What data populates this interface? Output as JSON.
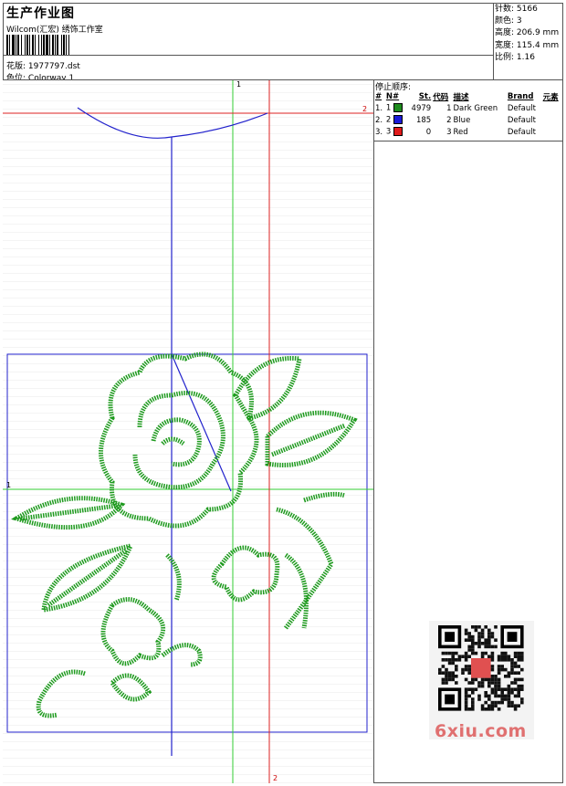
{
  "header": {
    "title": "生产作业图",
    "company": "Wilcom(汇宏) 绣饰工作室",
    "design_label": "花版:",
    "design_value": "1977797.dst",
    "colorway_label": "色位:",
    "colorway_value": "Colorway 1"
  },
  "stats": {
    "stitches_label": "针数:",
    "stitches_value": "5166",
    "colors_label": "颜色:",
    "colors_value": "3",
    "height_label": "高度:",
    "height_value": "206.9 mm",
    "width_label": "宽度:",
    "width_value": "115.4 mm",
    "ratio_label": "比例:",
    "ratio_value": "1.16"
  },
  "stop_sequence": {
    "title": "停止顺序:",
    "columns": [
      "#",
      "N#",
      "St.",
      "代码",
      "描述",
      "Brand",
      "元素"
    ],
    "rows": [
      {
        "index": "1.",
        "n": "1",
        "color": "#1e8c1e",
        "stitches": "4979",
        "code": "1",
        "desc": "Dark Green",
        "brand": "Default"
      },
      {
        "index": "2.",
        "n": "2",
        "color": "#1a1ad8",
        "stitches": "185",
        "code": "2",
        "desc": "Blue",
        "brand": "Default"
      },
      {
        "index": "3.",
        "n": "3",
        "color": "#e01a1a",
        "stitches": "0",
        "code": "3",
        "desc": "Red",
        "brand": "Default"
      }
    ]
  },
  "canvas": {
    "marker_top": "1",
    "marker_right": "2",
    "marker_left": "1",
    "marker_bottom": "2"
  },
  "watermark": "6xiu.com"
}
